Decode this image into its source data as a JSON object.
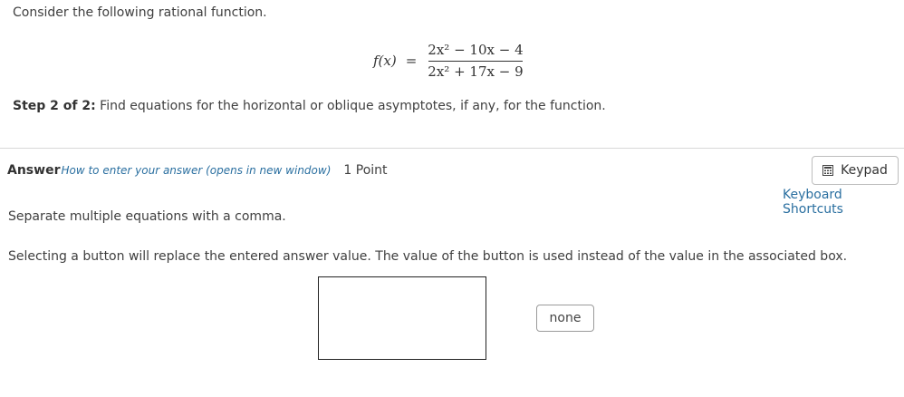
{
  "question": {
    "intro": "Consider the following rational function.",
    "function_name": "f(x)",
    "equals": "=",
    "numerator": "2x² − 10x − 4",
    "denominator": "2x² + 17x − 9",
    "step_label": "Step 2 of 2:",
    "step_text": " Find equations for the horizontal or oblique asymptotes, if any, for the function."
  },
  "answer": {
    "label": "Answer",
    "howto_link": "How to enter your answer (opens in new window)",
    "points": "1 Point",
    "keypad_label": "Keypad",
    "keyboard_shortcuts": "Keyboard Shortcuts",
    "separate_hint": "Separate multiple equations with a comma.",
    "selecting_hint": "Selecting a button will replace the entered answer value. The value of the button is used instead of the value in the associated box.",
    "input_value": "",
    "none_button": "none"
  },
  "icons": {
    "keypad": "keypad-icon"
  }
}
